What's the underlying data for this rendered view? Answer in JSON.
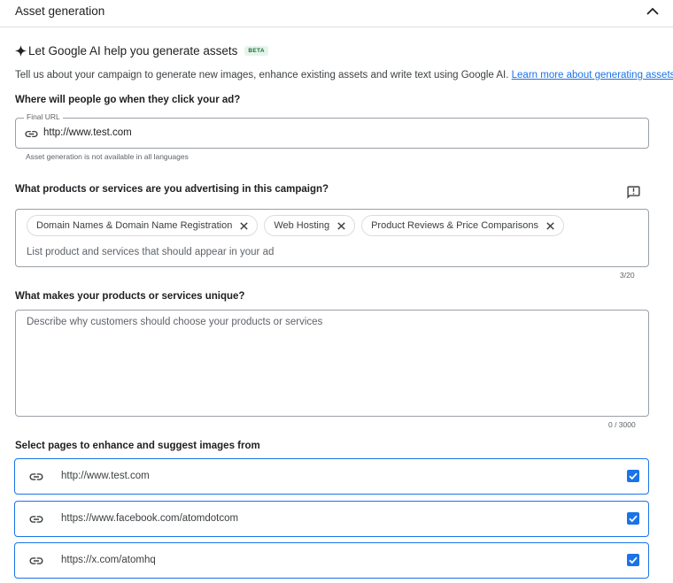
{
  "header": {
    "title": "Asset generation"
  },
  "ai": {
    "heading": "Let Google AI help you generate assets",
    "badge": "BETA",
    "intro": "Tell us about your campaign to generate new images, enhance existing assets and write text using Google AI. ",
    "learn_more": "Learn more about generating assets"
  },
  "final_url": {
    "question": "Where will people go when they click your ad?",
    "label": "Final URL",
    "value": "http://www.test.com",
    "helper": "Asset generation is not available in all languages"
  },
  "products": {
    "question": "What products or services are you advertising in this campaign?",
    "chips": [
      {
        "label": "Domain Names & Domain Name Registration"
      },
      {
        "label": "Web Hosting"
      },
      {
        "label": "Product Reviews & Price Comparisons"
      }
    ],
    "placeholder": "List product and services that should appear in your ad",
    "counter": "3/20"
  },
  "unique": {
    "question": "What makes your products or services unique?",
    "placeholder": "Describe why customers should choose your products or services",
    "counter": "0 / 3000"
  },
  "pages": {
    "question": "Select pages to enhance and suggest images from",
    "items": [
      {
        "url": "http://www.test.com",
        "checked": true
      },
      {
        "url": "https://www.facebook.com/atomdotcom",
        "checked": true
      },
      {
        "url": "https://x.com/atomhq",
        "checked": true
      }
    ]
  },
  "colors": {
    "accent": "#1a73e8",
    "border": "#9aa0a6",
    "beta_text": "#137333",
    "beta_bg": "#e6f4ea"
  },
  "icons": [
    "chevron-up-icon",
    "sparkle-icon",
    "link-icon",
    "close-icon",
    "feedback-icon",
    "checkbox-checked-icon"
  ]
}
